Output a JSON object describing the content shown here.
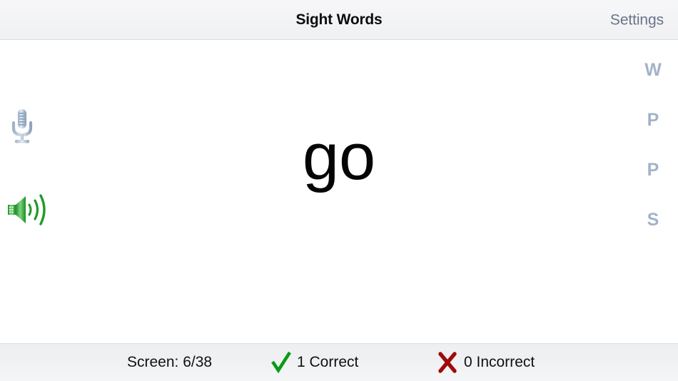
{
  "navbar": {
    "title": "Sight Words",
    "settings_label": "Settings",
    "settings_color": "#69748a"
  },
  "main": {
    "word": "go",
    "mic_icon": "microphone-icon",
    "speaker_icon": "speaker-volume-icon",
    "speaker_color": "#22a12a",
    "letter_rail": [
      {
        "label": "W"
      },
      {
        "label": "P"
      },
      {
        "label": "P"
      },
      {
        "label": "S"
      }
    ],
    "letter_rail_color": "#a3b3c6"
  },
  "statusbar": {
    "screen_label": "Screen: 6/38",
    "correct_label": "1 Correct",
    "incorrect_label": "0 Incorrect",
    "correct_icon": "check-mark-icon",
    "incorrect_icon": "cross-mark-icon",
    "correct_color": "#0a9a16",
    "incorrect_color": "#9e0b0b"
  }
}
